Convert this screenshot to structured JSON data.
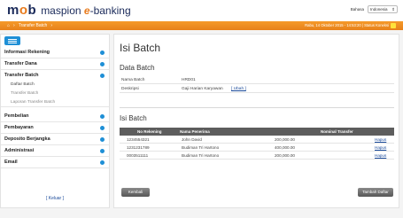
{
  "header": {
    "logo_text": "mob",
    "brand": "maspion",
    "brand_suffix": "banking",
    "language_label": "Bahasa",
    "language_value": "Indonesia"
  },
  "navbar": {
    "breadcrumb": "Transfer Batch",
    "info": "Rabu, 14 Oktober 2015 - 14:53:20 | Status Koneksi"
  },
  "sidebar": {
    "items": [
      {
        "label": "Informasi Rekening"
      },
      {
        "label": "Transfer Dana"
      },
      {
        "label": "Transfer Batch"
      },
      {
        "label": "Pembelian"
      },
      {
        "label": "Pembayaran"
      },
      {
        "label": "Deposito Berjangka"
      },
      {
        "label": "Administrasi"
      },
      {
        "label": "Email"
      }
    ],
    "sub_items": [
      {
        "label": "Daftar Batch"
      },
      {
        "label": "Transfer Batch"
      },
      {
        "label": "Laporan Transfer Batch"
      }
    ],
    "logout": "[ Keluar ]"
  },
  "main": {
    "title": "Isi Batch",
    "data_batch_title": "Data Batch",
    "fields": [
      {
        "label": "Nama Batch",
        "value": "HRD01"
      },
      {
        "label": "Deskripsi",
        "value": "Gaji Harian Karyawan",
        "link": "[ Ubah ]"
      }
    ],
    "isi_batch_title": "Isi Batch",
    "table": {
      "headers": [
        "No Rekening",
        "Nama Penerima",
        "",
        "Nominal Transfer",
        ""
      ],
      "rows": [
        {
          "account": "1234554321",
          "name": "John David",
          "amount": "200,000.00",
          "action": "Hapus"
        },
        {
          "account": "1231231789",
          "name": "Budiman Tri Hartono",
          "amount": "400,000.00",
          "action": "Hapus"
        },
        {
          "account": "0003511111",
          "name": "Budiman Tri Hartono",
          "amount": "200,000.00",
          "action": "Hapus"
        }
      ]
    },
    "back_button": "Kembali",
    "add_list_button": "Tambah Daftar"
  },
  "colors": {
    "accent_orange": "#f59a2a",
    "accent_blue": "#1e8fd6",
    "brand_navy": "#1a2a5a"
  }
}
